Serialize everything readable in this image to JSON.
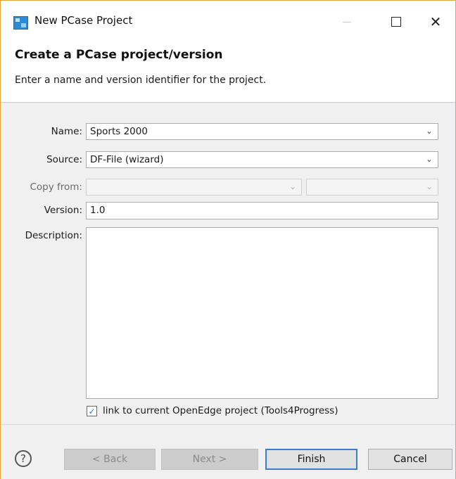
{
  "window": {
    "title": "New PCase Project",
    "controls": {
      "minimize": "—",
      "maximize": "☐",
      "close": "✕"
    }
  },
  "header": {
    "title": "Create a PCase project/version",
    "description": "Enter a name and version identifier for the project."
  },
  "form": {
    "name": {
      "label": "Name:",
      "value": "Sports 2000"
    },
    "source": {
      "label": "Source:",
      "value": "DF-File (wizard)"
    },
    "copy_from": {
      "label": "Copy from:",
      "value1": "",
      "value2": ""
    },
    "version": {
      "label": "Version:",
      "value": "1.0"
    },
    "description": {
      "label": "Description:",
      "value": ""
    },
    "link_checkbox": {
      "label": "link to current OpenEdge project (Tools4Progress)",
      "checked": true
    }
  },
  "buttons": {
    "help": "?",
    "back": "< Back",
    "next": "Next >",
    "finish": "Finish",
    "cancel": "Cancel"
  },
  "icons": {
    "chevron": "⌄",
    "check": "✓"
  },
  "colors": {
    "window_border": "#e3a63a",
    "dialog_bg": "#f0f0f0",
    "focus_blue": "#3d7bd0"
  }
}
